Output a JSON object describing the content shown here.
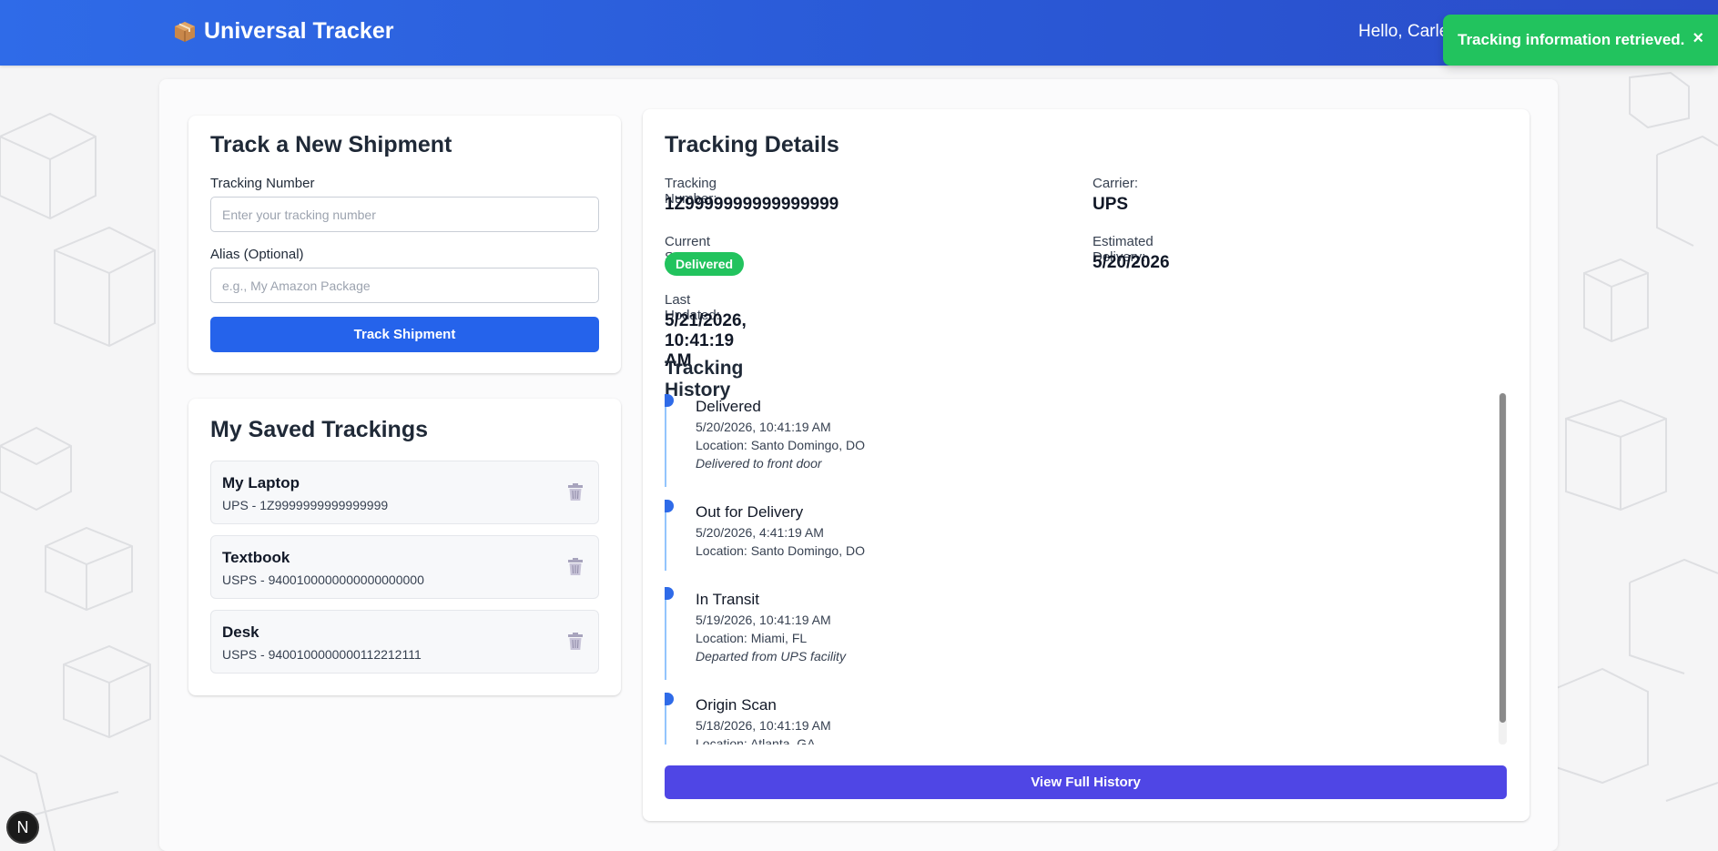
{
  "app": {
    "title": "Universal Tracker",
    "brand_icon": "package-icon",
    "greeting": "Hello, Carle"
  },
  "toast": {
    "message": "Tracking information retrieved.",
    "close": "×"
  },
  "track_form": {
    "title": "Track a New Shipment",
    "tracking_label": "Tracking Number",
    "tracking_placeholder": "Enter your tracking number",
    "tracking_value": "",
    "alias_label": "Alias (Optional)",
    "alias_placeholder": "e.g., My Amazon Package",
    "alias_value": "",
    "submit_label": "Track Shipment"
  },
  "saved": {
    "title": "My Saved Trackings",
    "items": [
      {
        "alias": "My Laptop",
        "detail": "UPS - 1Z9999999999999999"
      },
      {
        "alias": "Textbook",
        "detail": "USPS - 9400100000000000000000"
      },
      {
        "alias": "Desk",
        "detail": "USPS - 9400100000000112212111"
      }
    ]
  },
  "details": {
    "title": "Tracking Details",
    "tracking_number_label": "Tracking Number:",
    "tracking_number": "1Z9999999999999999",
    "carrier_label": "Carrier:",
    "carrier": "UPS",
    "status_label": "Current Status:",
    "status": "Delivered",
    "estimated_label": "Estimated Delivery:",
    "estimated": "5/20/2026",
    "updated_label": "Last Updated:",
    "updated": "5/21/2026, 10:41:19 AM"
  },
  "history": {
    "title": "Tracking History",
    "events": [
      {
        "status": "Delivered",
        "time": "5/20/2026, 10:41:19 AM",
        "location": "Location: Santo Domingo, DO",
        "note": "Delivered to front door"
      },
      {
        "status": "Out for Delivery",
        "time": "5/20/2026, 4:41:19 AM",
        "location": "Location: Santo Domingo, DO",
        "note": ""
      },
      {
        "status": "In Transit",
        "time": "5/19/2026, 10:41:19 AM",
        "location": "Location: Miami, FL",
        "note": "Departed from UPS facility"
      },
      {
        "status": "Origin Scan",
        "time": "5/18/2026, 10:41:19 AM",
        "location": "Location: Atlanta, GA",
        "note": ""
      }
    ],
    "view_full_label": "View Full History"
  },
  "dev_badge": "N",
  "colors": {
    "header": "#2b5be0",
    "primary_button": "#2563eb",
    "history_button": "#4f46e5",
    "success": "#22c35e",
    "timeline": "#93c5fd"
  }
}
